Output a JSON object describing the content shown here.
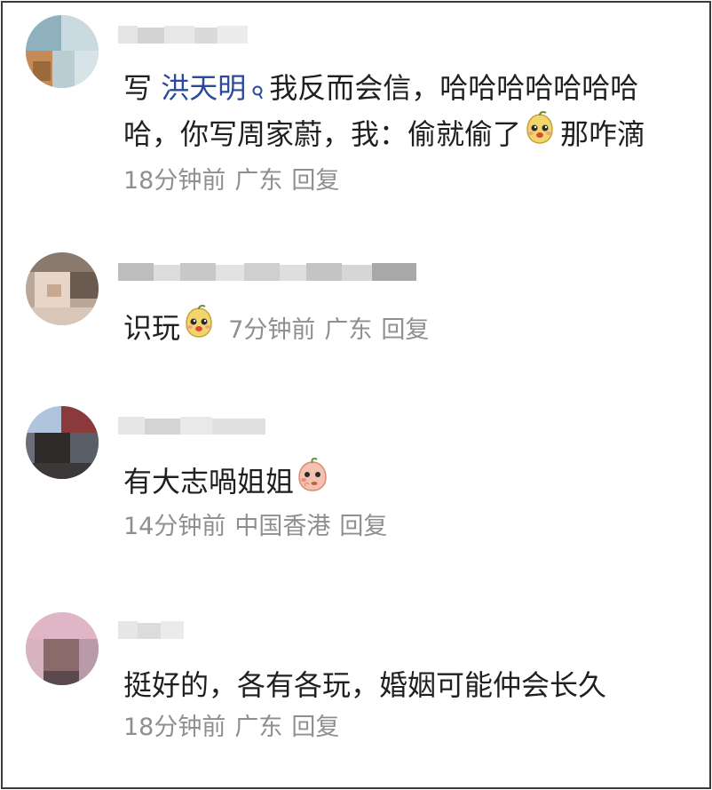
{
  "comments": [
    {
      "text_pre": "写 ",
      "mention": "洪天明",
      "text_post": "我反而会信，哈哈哈哈哈哈哈哈，你写周家蔚，我：偷就偷了",
      "text_after_emoji": "那咋滴",
      "emoji": "pear-face-icon",
      "time": "18分钟前",
      "location": "广东",
      "reply": "回复"
    },
    {
      "text": "识玩",
      "emoji": "pear-face-icon",
      "time": "7分钟前",
      "location": "广东",
      "reply": "回复"
    },
    {
      "text": "有大志喎姐姐",
      "emoji": "peach-thinking-icon",
      "time": "14分钟前",
      "location": "中国香港",
      "reply": "回复"
    },
    {
      "text": "挺好的，各有各玩，婚姻可能仲会长久",
      "time": "18分钟前",
      "location": "广东",
      "reply": "回复"
    }
  ],
  "colors": {
    "mention": "#2a4a9c",
    "meta": "#8f8f8f",
    "text": "#1f1f1f",
    "border": "#3a3a3a"
  }
}
